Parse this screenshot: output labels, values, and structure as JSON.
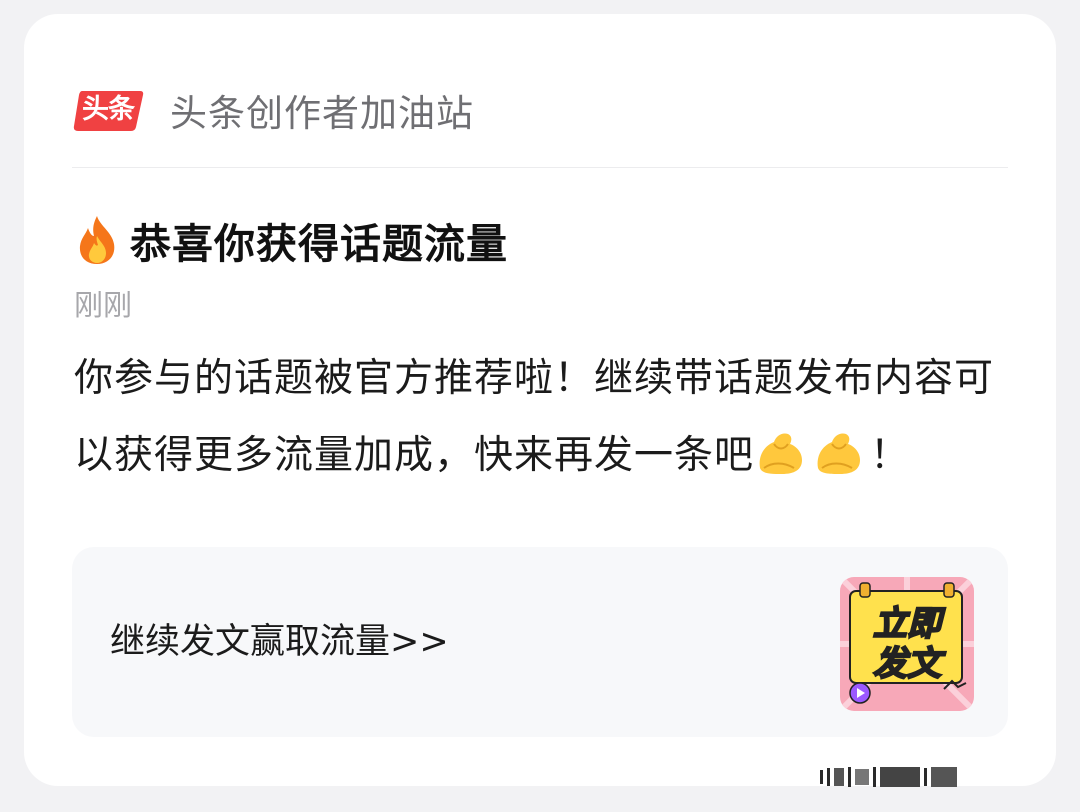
{
  "app": {
    "logo_text": "头条",
    "name": "头条创作者加油站"
  },
  "notification": {
    "title": "恭喜你获得话题流量",
    "title_icon": "fire-icon",
    "timestamp": "刚刚",
    "message_part1": "你参与的话题被官方推荐啦！继续带话题发布内容可以获得更多流量加成，快来再发一条吧",
    "message_emoji": "flexed-biceps-icon",
    "message_end": "！"
  },
  "action": {
    "label": "继续发文赢取流量>>",
    "thumbnail_line1": "立即",
    "thumbnail_line2": "发文"
  },
  "colors": {
    "brand_red": "#f04142",
    "card_bg": "#ffffff",
    "page_bg": "#f2f2f4",
    "action_bg": "#f7f8fa",
    "thumb_pink": "#f7a8b8",
    "thumb_yellow": "#ffe14d"
  }
}
